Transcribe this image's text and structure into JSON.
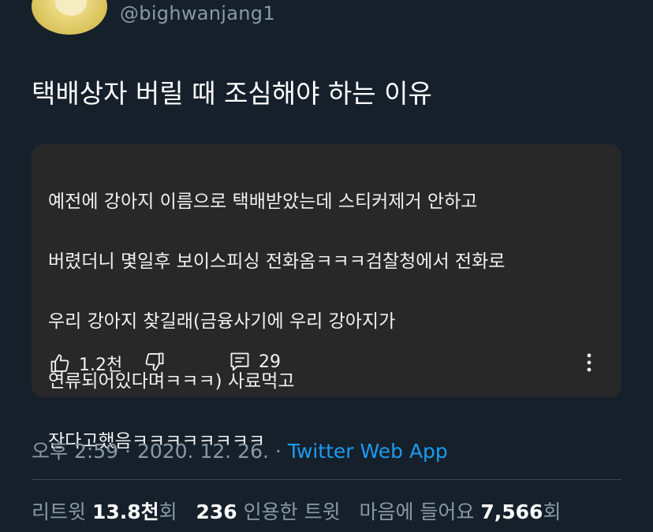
{
  "profile": {
    "handle": "@bighwanjang1"
  },
  "tweet": {
    "text": "택배상자 버릴 때 조심해야 하는 이유"
  },
  "embedded_comment": {
    "lines": [
      "예전에 강아지 이름으로 택배받았는데  스티커제거 안하고",
      "버렸더니 몇일후 보이스피싱 전화옴ㅋㅋㅋ검찰청에서  전화로",
      "우리 강아지 찾길래(금융사기에 우리 강아지가",
      "연류되어있다며ㅋㅋㅋ) 사료먹고",
      "잔다고했음ㅋㅋㅋㅋㅋㅋㅋㅋ"
    ],
    "like_count": "1.2천",
    "reply_count": "29",
    "icons": [
      "thumb-up-icon",
      "thumb-down-icon",
      "comment-icon",
      "more-vertical-icon"
    ]
  },
  "meta": {
    "time": "오후 2:59",
    "separator": " · ",
    "date": "2020. 12. 26.",
    "source": "Twitter Web App"
  },
  "stats": {
    "retweets_label": "리트윗",
    "retweets_count": "13.8천",
    "retweets_suffix": "회",
    "quotes_count": "236",
    "quotes_label": "인용한 트윗",
    "likes_label": "마음에 들어요",
    "likes_count": "7,566",
    "likes_suffix": "회"
  },
  "colors": {
    "background": "#15202b",
    "card": "#282828",
    "muted": "#8b98a5",
    "link": "#1d9bf0"
  }
}
